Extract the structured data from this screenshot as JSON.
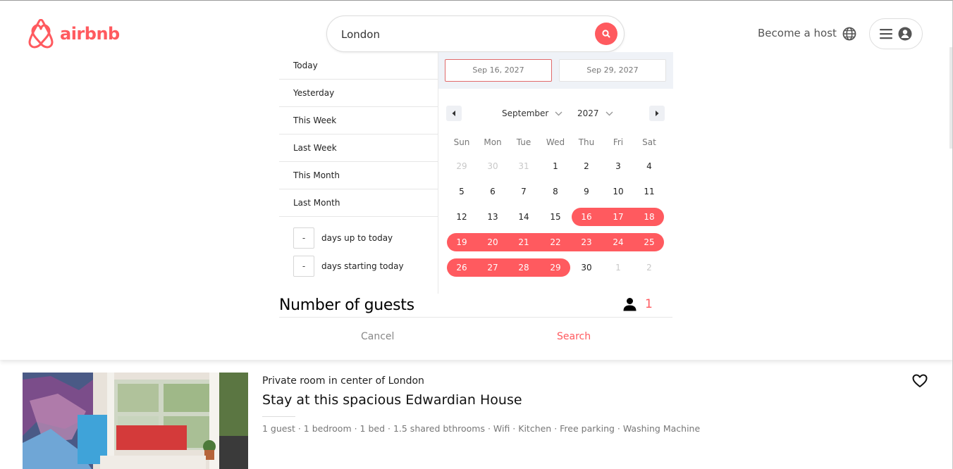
{
  "brand": {
    "name": "airbnb",
    "accent_color": "#ff5a5f"
  },
  "search": {
    "value": "London",
    "button_icon": "search-icon"
  },
  "header_nav": {
    "become_host": "Become a host",
    "globe_icon": "globe-icon",
    "menu_icon": "hamburger-menu-icon",
    "avatar_icon": "user-avatar-icon"
  },
  "date_picker": {
    "start_date": "Sep 16, 2027",
    "end_date": "Sep 29, 2027",
    "presets": [
      "Today",
      "Yesterday",
      "This Week",
      "Last Week",
      "This Month",
      "Last Month"
    ],
    "range_inputs": [
      {
        "value": "-",
        "label": "days up to today"
      },
      {
        "value": "-",
        "label": "days starting today"
      }
    ],
    "month": "September",
    "year": "2027",
    "weekdays": [
      "Sun",
      "Mon",
      "Tue",
      "Wed",
      "Thu",
      "Fri",
      "Sat"
    ],
    "weeks": [
      [
        "29",
        "30",
        "31",
        "1",
        "2",
        "3",
        "4"
      ],
      [
        "5",
        "6",
        "7",
        "8",
        "9",
        "10",
        "11"
      ],
      [
        "12",
        "13",
        "14",
        "15",
        "16",
        "17",
        "18"
      ],
      [
        "19",
        "20",
        "21",
        "22",
        "23",
        "24",
        "25"
      ],
      [
        "26",
        "27",
        "28",
        "29",
        "30",
        "1",
        "2"
      ]
    ],
    "selected_range_start": 16,
    "selected_range_end": 29
  },
  "guests": {
    "title": "Number of guests",
    "count": "1",
    "icon": "person-icon"
  },
  "actions": {
    "cancel": "Cancel",
    "search": "Search"
  },
  "listing": {
    "subtitle": "Private room in center of London",
    "title": "Stay at this spacious Edwardian House",
    "details": "1 guest · 1 bedroom · 1 bed · 1.5 shared bthrooms · Wifi · Kitchen · Free parking · Washing Machine",
    "favorite_icon": "heart-icon"
  }
}
